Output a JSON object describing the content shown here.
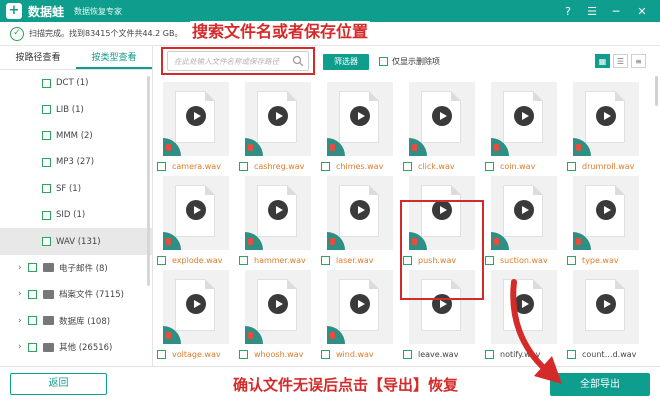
{
  "app": {
    "logo_char": "+",
    "name": "数据蛙",
    "subtitle": "数据恢复专家",
    "controls": [
      "?",
      "☰",
      "─",
      "✕"
    ]
  },
  "status": {
    "text": "扫描完成。找到83415个文件共44.2 GB。"
  },
  "sidebar": {
    "tabs": [
      {
        "label": "按路径查看",
        "active": false
      },
      {
        "label": "按类型查看",
        "active": true
      }
    ],
    "items": [
      {
        "label": "DCT (1)",
        "level": "child",
        "expand": ""
      },
      {
        "label": "LIB (1)",
        "level": "child",
        "expand": ""
      },
      {
        "label": "MMM (2)",
        "level": "child",
        "expand": ""
      },
      {
        "label": "MP3 (27)",
        "level": "child",
        "expand": ""
      },
      {
        "label": "SF (1)",
        "level": "child",
        "expand": ""
      },
      {
        "label": "SID (1)",
        "level": "child",
        "expand": ""
      },
      {
        "label": "WAV (131)",
        "level": "child",
        "expand": "",
        "selected": true
      },
      {
        "label": "电子邮件 (8)",
        "level": "parent",
        "expand": "›"
      },
      {
        "label": "档案文件 (7115)",
        "level": "parent",
        "expand": "›"
      },
      {
        "label": "数据库 (108)",
        "level": "parent",
        "expand": "›"
      },
      {
        "label": "其他 (26516)",
        "level": "parent",
        "expand": "›"
      }
    ]
  },
  "toolbar": {
    "search_placeholder": "在此处输入文件名称或保存路径",
    "filter_label": "筛选器",
    "only_deleted_label": "仅显示删除项",
    "view_icons": [
      "▦",
      "☰",
      "≡"
    ]
  },
  "files": [
    {
      "name": "camera.wav",
      "deleted": true
    },
    {
      "name": "cashreg.wav",
      "deleted": true
    },
    {
      "name": "chimes.wav",
      "deleted": true
    },
    {
      "name": "click.wav",
      "deleted": true
    },
    {
      "name": "coin.wav",
      "deleted": true
    },
    {
      "name": "drumroll.wav",
      "deleted": true
    },
    {
      "name": "explode.wav",
      "deleted": true
    },
    {
      "name": "hammer.wav",
      "deleted": true
    },
    {
      "name": "laser.wav",
      "deleted": true
    },
    {
      "name": "push.wav",
      "deleted": true
    },
    {
      "name": "suction.wav",
      "deleted": true
    },
    {
      "name": "type.wav",
      "deleted": true
    },
    {
      "name": "voltage.wav",
      "deleted": true
    },
    {
      "name": "whoosh.wav",
      "deleted": true
    },
    {
      "name": "wind.wav",
      "deleted": true
    },
    {
      "name": "leave.wav",
      "deleted": false
    },
    {
      "name": "notify.wav",
      "deleted": false
    },
    {
      "name": "count…d.wav",
      "deleted": false
    }
  ],
  "footer": {
    "back_label": "返回",
    "export_label": "全部导出"
  },
  "annotations": {
    "top": "搜索文件名或者保存位置",
    "bottom": "确认文件无误后点击【导出】恢复"
  },
  "colors": {
    "brand": "#0f9e8e",
    "annotation": "#d42a2a",
    "deleted_name": "#e07b2a"
  }
}
